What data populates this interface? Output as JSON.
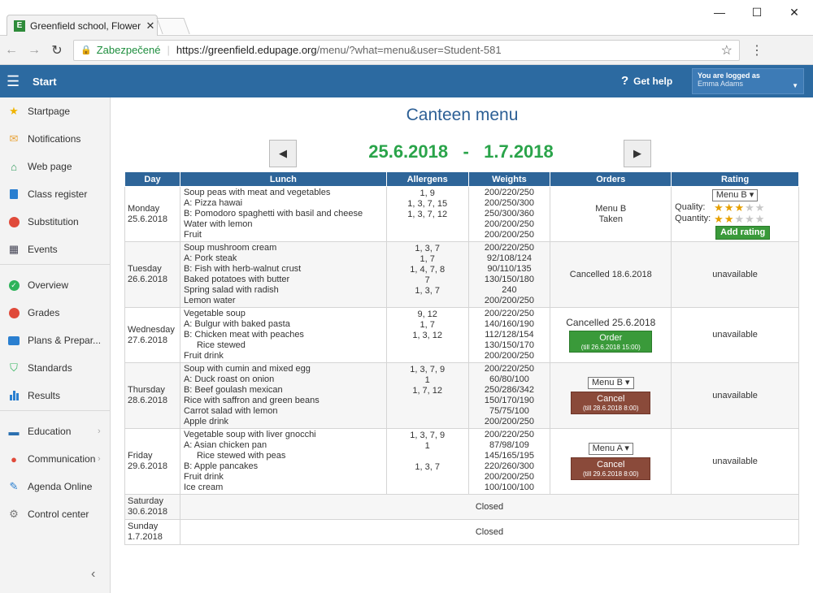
{
  "browser": {
    "tab_title": "Greenfield school, Flower",
    "tab_favicon": "E",
    "secure_label": "Zabezpečené",
    "url_host": "https://greenfield.edupage.org",
    "url_path": "/menu/?what=menu&user=Student-581"
  },
  "header": {
    "start": "Start",
    "help": "Get help",
    "logged_as": "You are logged as",
    "user_name": "Emma Adams"
  },
  "sidebar": {
    "items": [
      {
        "label": "Startpage",
        "icon": "star-icon"
      },
      {
        "label": "Notifications",
        "icon": "envelope-icon"
      },
      {
        "label": "Web page",
        "icon": "home-icon"
      },
      {
        "label": "Class register",
        "icon": "book-icon"
      },
      {
        "label": "Substitution",
        "icon": "person-icon"
      },
      {
        "label": "Events",
        "icon": "calendar-icon"
      },
      {
        "label": "Overview",
        "icon": "check-circle-icon"
      },
      {
        "label": "Grades",
        "icon": "grades-icon"
      },
      {
        "label": "Plans & Prepar...",
        "icon": "briefcase-icon"
      },
      {
        "label": "Standards",
        "icon": "shield-icon"
      },
      {
        "label": "Results",
        "icon": "bar-chart-icon"
      },
      {
        "label": "Education",
        "icon": "education-icon"
      },
      {
        "label": "Communication",
        "icon": "chat-icon"
      },
      {
        "label": "Agenda Online",
        "icon": "pen-icon"
      },
      {
        "label": "Control center",
        "icon": "gear-icon"
      }
    ]
  },
  "main": {
    "title": "Canteen menu",
    "date_from": "25.6.2018",
    "date_sep": "-",
    "date_to": "1.7.2018",
    "columns": [
      "Day",
      "Lunch",
      "Allergens",
      "Weights",
      "Orders",
      "Rating"
    ],
    "days": [
      {
        "day": "Monday",
        "date": "25.6.2018",
        "lunch": [
          "Soup peas with meat and vegetables",
          "A: Pizza hawai",
          "B: Pomodoro spaghetti with basil and cheese",
          "Water with lemon",
          "Fruit"
        ],
        "allergens": [
          "1, 9",
          "1, 3, 7, 15",
          "1, 3, 7, 12"
        ],
        "weights": [
          "200/220/250",
          "200/250/300",
          "250/300/360",
          "200/200/250",
          "200/200/250"
        ],
        "order_line1": "Menu B",
        "order_line2": "Taken",
        "rating_select": "Menu B",
        "quality_label": "Quality:",
        "quantity_label": "Quantity:",
        "quality_stars": 3,
        "quantity_stars": 2,
        "add_rating": "Add rating"
      },
      {
        "day": "Tuesday",
        "date": "26.6.2018",
        "lunch": [
          "Soup mushroom cream",
          "A: Pork steak",
          "B: Fish with herb-walnut crust",
          "Baked potatoes with butter",
          "Spring salad with radish",
          "Lemon water"
        ],
        "allergens": [
          "1, 3, 7",
          "1, 7",
          "1, 4, 7, 8",
          "7",
          "1, 3, 7"
        ],
        "weights": [
          "200/220/250",
          "92/108/124",
          "90/110/135",
          "130/150/180",
          "240",
          "200/200/250"
        ],
        "order_text": "Cancelled 18.6.2018",
        "rating": "unavailable"
      },
      {
        "day": "Wednesday",
        "date": "27.6.2018",
        "lunch": [
          "Vegetable soup",
          "A: Bulgur with baked pasta",
          "B: Chicken meat with peaches",
          "Rice stewed",
          "Fruit drink"
        ],
        "allergens": [
          "9, 12",
          "1, 7",
          "1, 3, 12"
        ],
        "weights": [
          "200/220/250",
          "140/160/190",
          "112/128/154",
          "130/150/170",
          "200/200/250"
        ],
        "order_text": "Cancelled 25.6.2018",
        "order_btn": "Order",
        "order_btn_sub": "(till 26.6.2018 15:00)",
        "rating": "unavailable"
      },
      {
        "day": "Thursday",
        "date": "28.6.2018",
        "lunch": [
          "Soup with cumin and mixed egg",
          "A: Duck roast on onion",
          "B: Beef goulash mexican",
          "Rice with saffron and green beans",
          "Carrot salad with lemon",
          "Apple drink"
        ],
        "allergens": [
          "1, 3, 7, 9",
          "1",
          "1, 7, 12"
        ],
        "weights": [
          "200/220/250",
          "60/80/100",
          "250/286/342",
          "150/170/190",
          "75/75/100",
          "200/200/250"
        ],
        "order_select": "Menu B",
        "order_btn": "Cancel",
        "order_btn_sub": "(till 28.6.2018 8:00)",
        "rating": "unavailable"
      },
      {
        "day": "Friday",
        "date": "29.6.2018",
        "lunch": [
          "Vegetable soup with liver gnocchi",
          "A: Asian chicken pan",
          "Rice stewed with peas",
          "B: Apple pancakes",
          "Fruit drink",
          "Ice cream"
        ],
        "allergens": [
          "1, 3, 7, 9",
          "1",
          "",
          "1, 3, 7"
        ],
        "weights": [
          "200/220/250",
          "87/98/109",
          "145/165/195",
          "220/260/300",
          "200/200/250",
          "100/100/100"
        ],
        "order_select": "Menu A",
        "order_btn": "Cancel",
        "order_btn_sub": "(till 29.6.2018 8:00)",
        "rating": "unavailable"
      },
      {
        "day": "Saturday",
        "date": "30.6.2018",
        "status": "Closed"
      },
      {
        "day": "Sunday",
        "date": "1.7.2018",
        "status": "Closed"
      }
    ]
  },
  "colors": {
    "appbar": "#2c6aa1",
    "table_header": "#2e6599",
    "title": "#2c5f95",
    "date_range": "#2aa44a",
    "order_green": "#3a9a3a",
    "cancel_red": "#8a4a3a",
    "star": "#e6a000"
  }
}
